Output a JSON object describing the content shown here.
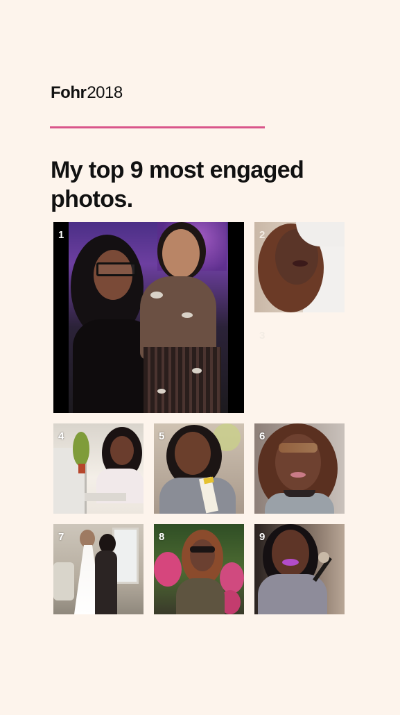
{
  "brand": {
    "name": "Fohr",
    "year": "2018"
  },
  "headline": "My top 9 most engaged photos.",
  "colors": {
    "background": "#fdf4ec",
    "accent_rule": "#d9558a",
    "text": "#111111",
    "tile_number": "#ffffff"
  },
  "photos": [
    {
      "rank": "1"
    },
    {
      "rank": "2"
    },
    {
      "rank": "3"
    },
    {
      "rank": "4"
    },
    {
      "rank": "5"
    },
    {
      "rank": "6"
    },
    {
      "rank": "7"
    },
    {
      "rank": "8"
    },
    {
      "rank": "9"
    }
  ]
}
